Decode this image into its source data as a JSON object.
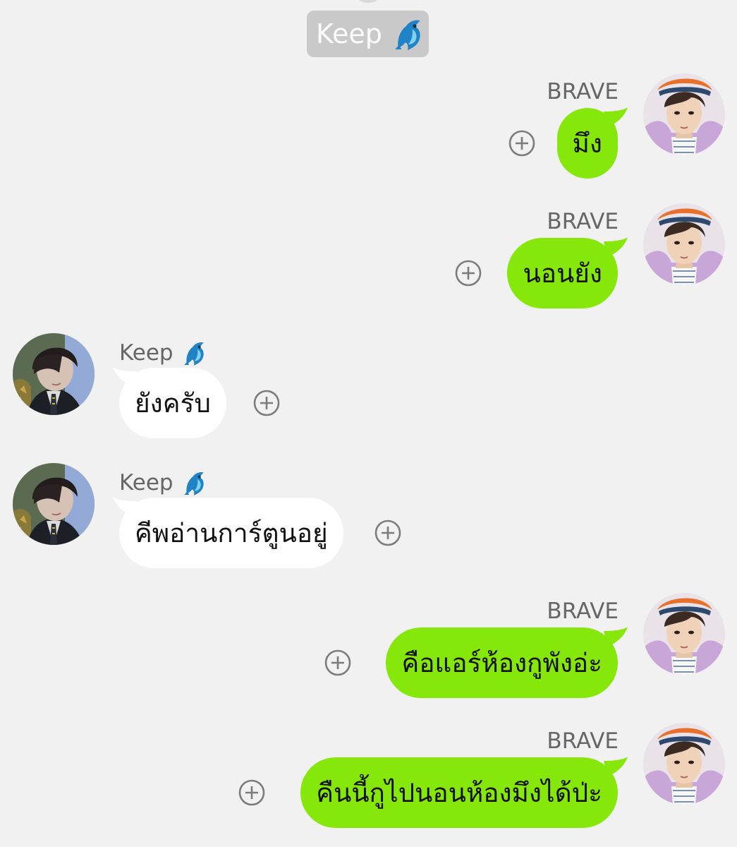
{
  "header_chip": {
    "name": "Keep",
    "icon": "dolphin-icon"
  },
  "colors": {
    "background": "#f1f1f1",
    "outgoing_bubble": "#86e80a",
    "incoming_bubble": "#ffffff",
    "chip": "#c9c9c9",
    "dolphin": "#1f83c6",
    "sender_text": "#666666"
  },
  "messages": [
    {
      "sender": "BRAVE",
      "text": "มึง",
      "direction": "outgoing"
    },
    {
      "sender": "BRAVE",
      "text": "นอนยัง",
      "direction": "outgoing"
    },
    {
      "sender": "Keep",
      "text": "ยังครับ",
      "direction": "incoming"
    },
    {
      "sender": "Keep",
      "text": "คีพอ่านการ์ตูนอยู่",
      "direction": "incoming"
    },
    {
      "sender": "BRAVE",
      "text": "คือแอร์ห้องกูพังอ่ะ",
      "direction": "outgoing"
    },
    {
      "sender": "BRAVE",
      "text": "คืนนี้กูไปนอนห้องมึงได้ป่ะ",
      "direction": "outgoing"
    }
  ]
}
